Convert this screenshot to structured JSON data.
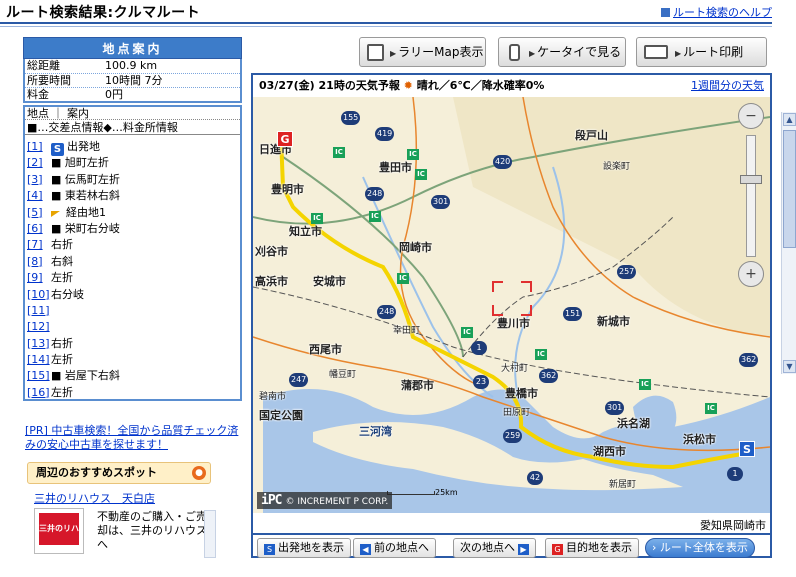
{
  "header": {
    "title": "ルート検索結果:クルマルート",
    "help_link": "ルート検索のヘルプ"
  },
  "points_panel": {
    "title": "地点案内",
    "summary": [
      {
        "label": "総距離",
        "value": "100.9 km"
      },
      {
        "label": "所要時間",
        "value": "10時間 7分"
      },
      {
        "label": "料金",
        "value": "0円"
      }
    ],
    "list_header": "地点 ｜ 案内",
    "legend": "■…交差点情報◆…料金所情報",
    "items": [
      {
        "num": "[1]",
        "badge": "S",
        "text": "出発地"
      },
      {
        "num": "[2]",
        "text": "■ 旭町左折"
      },
      {
        "num": "[3]",
        "text": "■ 伝馬町左折"
      },
      {
        "num": "[4]",
        "text": "■ 東若林右斜"
      },
      {
        "num": "[5]",
        "flag": true,
        "text": "経由地1"
      },
      {
        "num": "[6]",
        "text": "■ 栄町右分岐"
      },
      {
        "num": "[7]",
        "text": "右折"
      },
      {
        "num": "[8]",
        "text": "右斜"
      },
      {
        "num": "[9]",
        "text": "左折"
      },
      {
        "num": "[10]",
        "text": "右分岐"
      },
      {
        "num": "[11]",
        "text": ""
      },
      {
        "num": "[12]",
        "text": ""
      },
      {
        "num": "[13]",
        "text": "右折"
      },
      {
        "num": "[14]",
        "text": "左折"
      },
      {
        "num": "[15]",
        "text": "■ 岩屋下右斜"
      },
      {
        "num": "[16]",
        "text": "左折"
      }
    ]
  },
  "pr": {
    "text": "[PR] 中古車検索！全国から品質チェック済みの安心中古車を探せます！"
  },
  "spots": {
    "title": "周辺のおすすめスポット",
    "name": "三井のリハウス　天白店",
    "logo_text": "三井のリハウス",
    "description": "不動産のご購入・ご売却は、三井のリハウスへ"
  },
  "top_buttons": [
    {
      "label": "ラリーMap表示",
      "icon": "rally-map-icon"
    },
    {
      "label": "ケータイで見る",
      "icon": "mobile-phone-icon"
    },
    {
      "label": "ルート印刷",
      "icon": "printer-icon"
    }
  ],
  "weather": {
    "text": "03/27(金) 21時の天気予報",
    "icon": "sun-icon",
    "detail": "晴れ／6℃／降水確率0%",
    "weekly_link": "1週間分の天気"
  },
  "map": {
    "labels": {
      "danto": "段戸山",
      "shitara": "設楽町",
      "toyota": "豊田市",
      "toyoake": "豊明市",
      "nisshin": "日進市",
      "chiryu": "知立市",
      "kariya": "刈谷市",
      "okazaki": "岡崎市",
      "anjo": "安城市",
      "takahama": "高浜市",
      "toyokawa": "豊川市",
      "shinshiro": "新城市",
      "nishio": "西尾市",
      "kota": "幸田町",
      "hazu": "幡豆町",
      "gamagori": "蒲郡市",
      "toyohashi": "豊橋市",
      "otawa": "大村町",
      "mikawa_bay": "三河湾",
      "park": "国定公園",
      "hamanako": "浜名湖",
      "kosai": "湖西市",
      "hamamatsu": "浜松市",
      "shinkyo": "新居町",
      "hekinan": "碧南市",
      "tahara": "田原町"
    },
    "routes": [
      "155",
      "419",
      "420",
      "248",
      "301",
      "248",
      "151",
      "257",
      "362",
      "247",
      "23",
      "1",
      "259",
      "362",
      "301",
      "1",
      "42"
    ],
    "copyright": "© INCREMENT P CORP.",
    "brand": "iPC",
    "scale": "25km",
    "place_name": "愛知県岡崎市"
  },
  "map_buttons": [
    {
      "label": "出発地を表示",
      "icon": "S"
    },
    {
      "label": "前の地点へ",
      "icon": "◀"
    },
    {
      "label": "次の地点へ",
      "icon": "▶"
    },
    {
      "label": "目的地を表示",
      "icon": "G"
    },
    {
      "label": "ルート全体を表示",
      "icon": "›"
    }
  ],
  "colors": {
    "accent": "#2b5aa6",
    "header_blue": "#3d7cc9",
    "route_yellow": "#f4d400",
    "sea": "#a9c6e8",
    "land": "#f5efd9"
  }
}
